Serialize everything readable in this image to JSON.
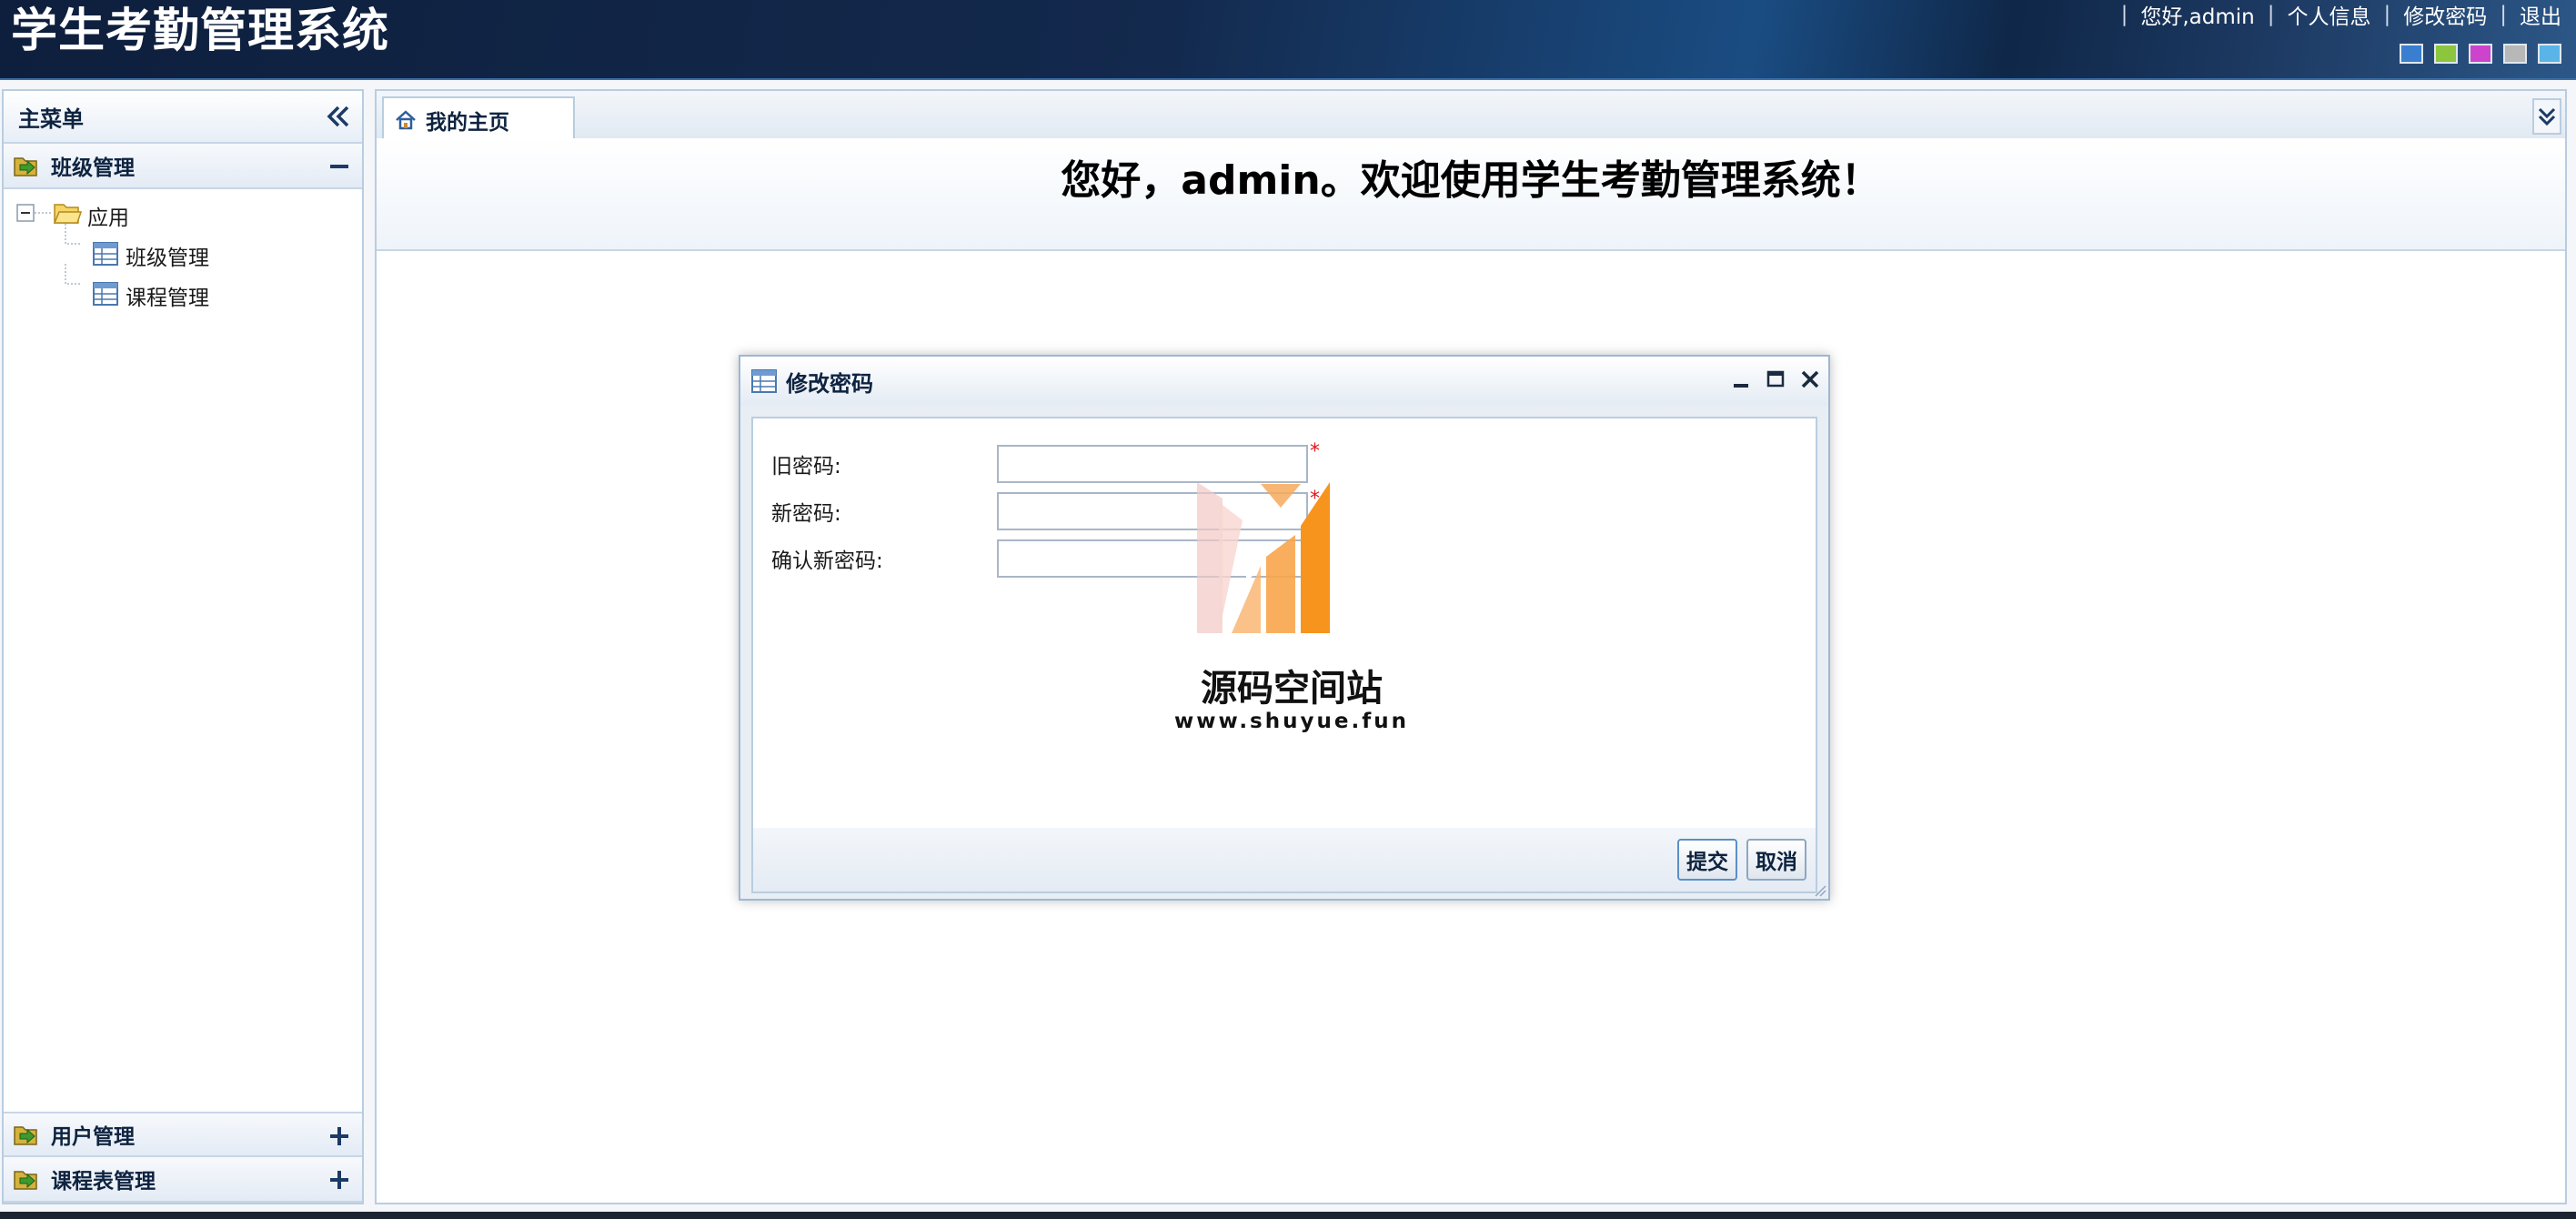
{
  "header": {
    "title": "学生考勤管理系统",
    "greeting": "您好,admin",
    "profile_link": "个人信息",
    "change_password_link": "修改密码",
    "logout_link": "退出",
    "separator": "|",
    "theme_swatches": [
      "#3a7fcf",
      "#8cc63e",
      "#cc44cc",
      "#b8b8b8",
      "#5ab4e8"
    ]
  },
  "sidebar": {
    "title": "主菜单",
    "sections": [
      {
        "label": "班级管理",
        "expanded": true
      },
      {
        "label": "用户管理",
        "expanded": false
      },
      {
        "label": "课程表管理",
        "expanded": false
      }
    ],
    "tree": {
      "root": "应用",
      "children": [
        "班级管理",
        "课程管理"
      ]
    }
  },
  "tabs": [
    {
      "label": "我的主页",
      "active": true
    }
  ],
  "main": {
    "welcome": "您好，admin。欢迎使用学生考勤管理系统！"
  },
  "dialog": {
    "title": "修改密码",
    "fields": [
      {
        "label": "旧密码:",
        "value": "",
        "required": "*"
      },
      {
        "label": "新密码:",
        "value": "",
        "required": "*"
      },
      {
        "label": "确认新密码:",
        "value": "",
        "required": "*"
      }
    ],
    "submit_label": "提交",
    "cancel_label": "取消"
  },
  "watermark": {
    "title": "源码空间站",
    "url": "www.shuyue.fun"
  },
  "colors": {
    "header_bg": "#13294d",
    "panel_border": "#b9cde0",
    "required_mark": "#e01818",
    "watermark_orange": "#f7941d"
  }
}
